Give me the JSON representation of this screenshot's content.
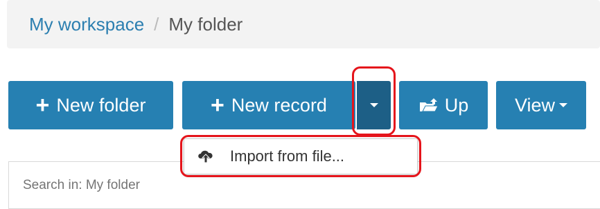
{
  "breadcrumb": {
    "workspace": "My workspace",
    "separator": "/",
    "folder": "My folder"
  },
  "toolbar": {
    "new_folder_label": "New folder",
    "new_record_label": "New record",
    "up_label": "Up",
    "view_label": "View",
    "plus_icon": "+"
  },
  "dropdown": {
    "items": [
      {
        "label": "Import from file...",
        "icon": "cloud-upload-icon"
      }
    ]
  },
  "search": {
    "placeholder": "Search in: My folder"
  },
  "colors": {
    "primary": "#2680b2",
    "primary_dark": "#1d5f86",
    "highlight": "#e5141b",
    "link": "#2c7fb0"
  }
}
